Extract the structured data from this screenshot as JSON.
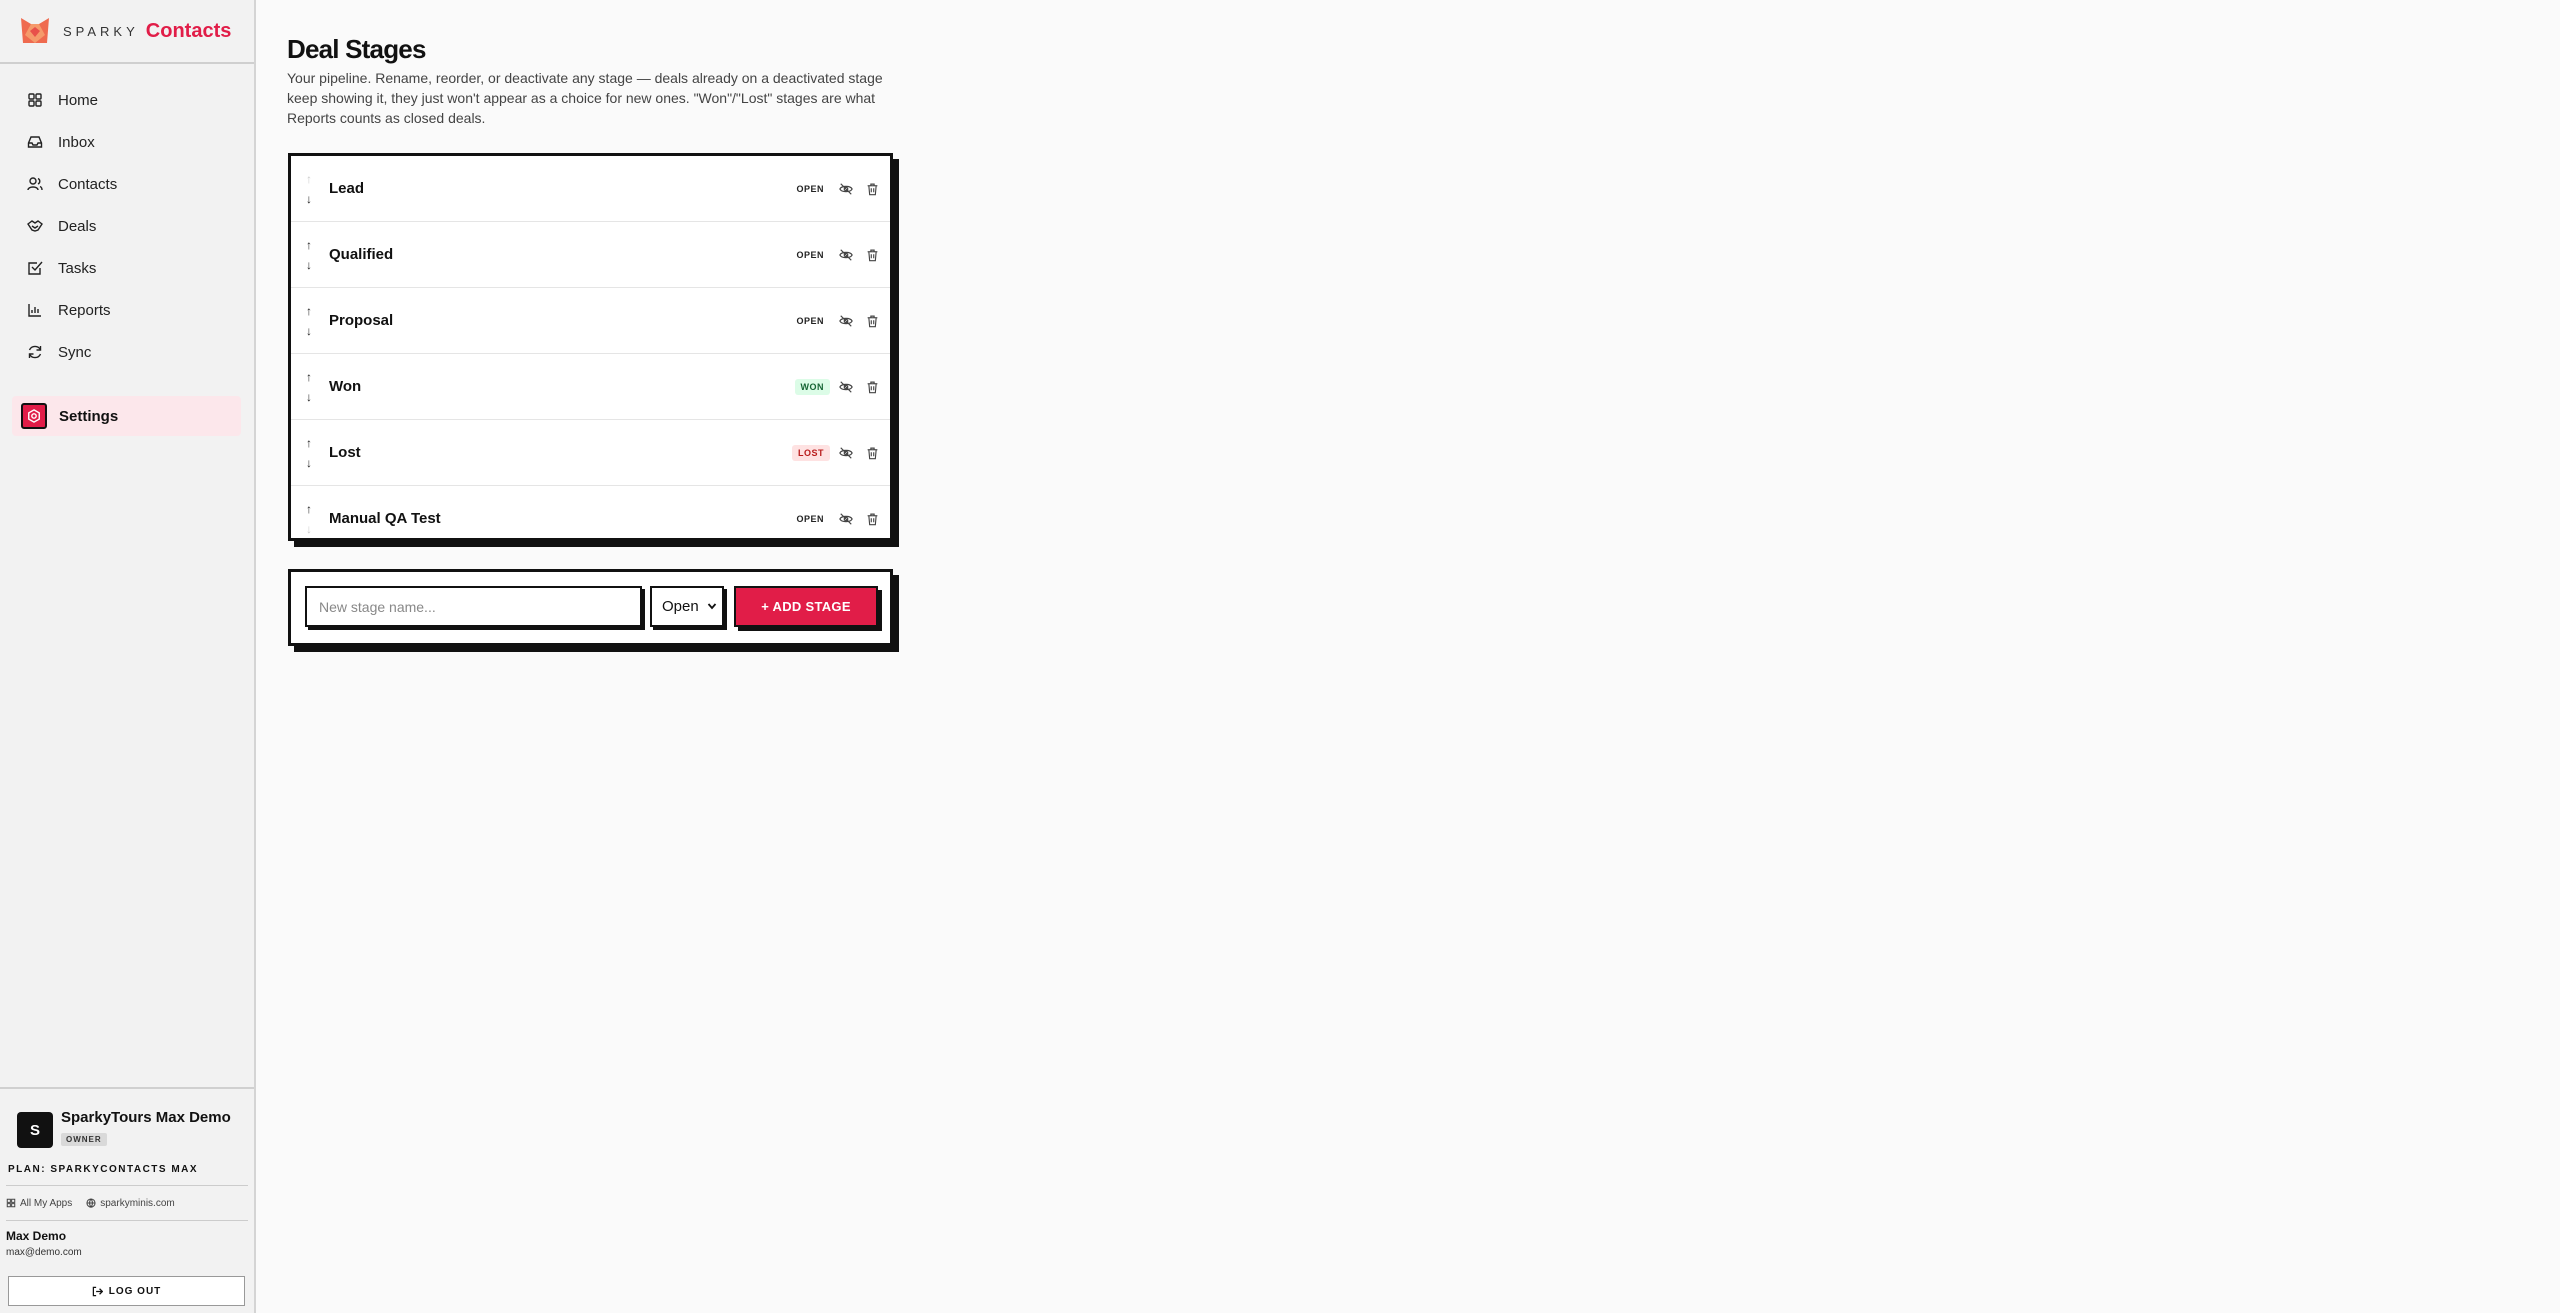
{
  "brand": {
    "sparky": "SPARKY",
    "contacts": "Contacts"
  },
  "nav": {
    "items": [
      {
        "label": "Home",
        "icon": "home-icon"
      },
      {
        "label": "Inbox",
        "icon": "inbox-icon"
      },
      {
        "label": "Contacts",
        "icon": "contacts-icon"
      },
      {
        "label": "Deals",
        "icon": "handshake-icon"
      },
      {
        "label": "Tasks",
        "icon": "tasks-icon"
      },
      {
        "label": "Reports",
        "icon": "bar-chart-icon"
      },
      {
        "label": "Sync",
        "icon": "sync-icon"
      }
    ],
    "active": {
      "label": "Settings",
      "icon": "settings-icon"
    }
  },
  "account": {
    "org_initial": "S",
    "org_name": "SparkyTours Max Demo",
    "role": "OWNER",
    "plan": "PLAN: SPARKYCONTACTS MAX",
    "link_apps": "All My Apps",
    "link_site": "sparkyminis.com",
    "user_name": "Max Demo",
    "user_email": "max@demo.com",
    "logout": "LOG OUT"
  },
  "page": {
    "title": "Deal Stages",
    "description": "Your pipeline. Rename, reorder, or deactivate any stage — deals already on a deactivated stage keep showing it, they just won't appear as a choice for new ones. \"Won\"/\"Lost\" stages are what Reports counts as closed deals."
  },
  "stages": [
    {
      "name": "Lead",
      "status": "OPEN"
    },
    {
      "name": "Qualified",
      "status": "OPEN"
    },
    {
      "name": "Proposal",
      "status": "OPEN"
    },
    {
      "name": "Won",
      "status": "WON"
    },
    {
      "name": "Lost",
      "status": "LOST"
    },
    {
      "name": "Manual QA Test",
      "status": "OPEN"
    }
  ],
  "add": {
    "placeholder": "New stage name...",
    "type_value": "Open",
    "button": "+ ADD STAGE"
  },
  "colors": {
    "accent": "#e11d48",
    "won_bg": "#dcfce7",
    "lost_bg": "#fee2e2"
  }
}
